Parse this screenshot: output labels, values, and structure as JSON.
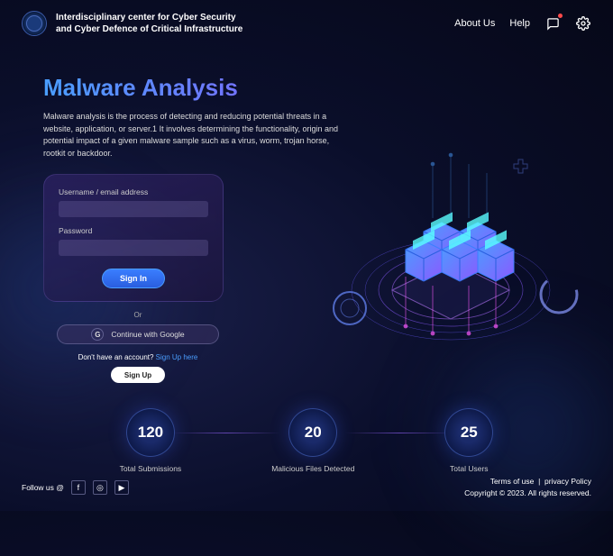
{
  "header": {
    "title": "Interdisciplinary center for Cyber Security and Cyber Defence of Critical Infrastructure",
    "about": "About Us",
    "help": "Help"
  },
  "hero": {
    "heading": "Malware Analysis",
    "description": "Malware analysis is the process of detecting and reducing potential threats in a website, application, or server.1 It involves determining the functionality, origin and potential impact of a given malware sample such as a virus, worm, trojan horse, rootkit or backdoor."
  },
  "login": {
    "username_label": "Username / email address",
    "password_label": "Password",
    "signin": "Sign In",
    "or": "Or",
    "google": "Continue with Google",
    "no_account": "Don't have an account?",
    "signup_here": "Sign Up here",
    "signup": "Sign Up"
  },
  "stats": [
    {
      "value": "120",
      "label": "Total Submissions"
    },
    {
      "value": "20",
      "label": "Malicious Files Detected"
    },
    {
      "value": "25",
      "label": "Total Users"
    }
  ],
  "footer": {
    "follow": "Follow us @",
    "terms": "Terms of use",
    "privacy": "privacy Policy",
    "copyright": "Copyright  ©  2023. All rights reserved."
  }
}
